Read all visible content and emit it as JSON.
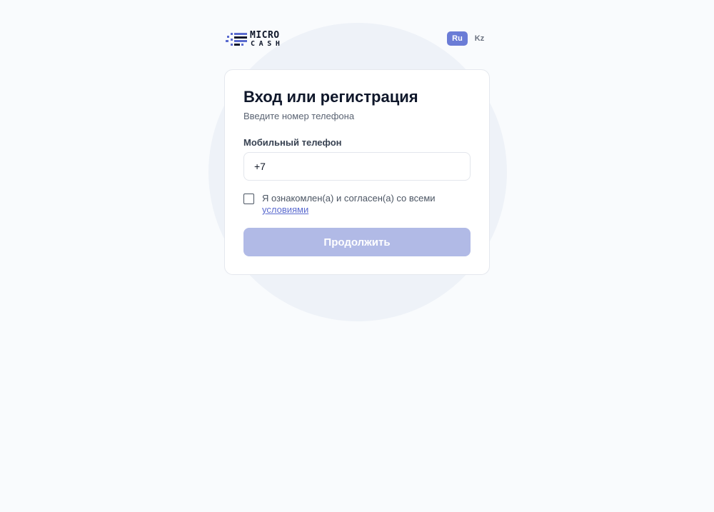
{
  "header": {
    "logo": {
      "line1": "MICRO",
      "line2": "CASH"
    },
    "languages": [
      {
        "label": "Ru",
        "active": true
      },
      {
        "label": "Kz",
        "active": false
      }
    ]
  },
  "form": {
    "title": "Вход или регистрация",
    "subtitle": "Введите номер телефона",
    "phone_label": "Мобильный телефон",
    "phone_value": "+7",
    "agreement_text": "Я ознакомлен(а) и согласен(а) со всеми",
    "agreement_link": "условиями",
    "agreement_checked": false,
    "submit_label": "Продолжить"
  },
  "colors": {
    "accent": "#6b7cd6",
    "button_disabled": "#b1bae6",
    "link": "#5b6bcf",
    "background": "#f9fbfd",
    "blob": "#eef2f8"
  }
}
